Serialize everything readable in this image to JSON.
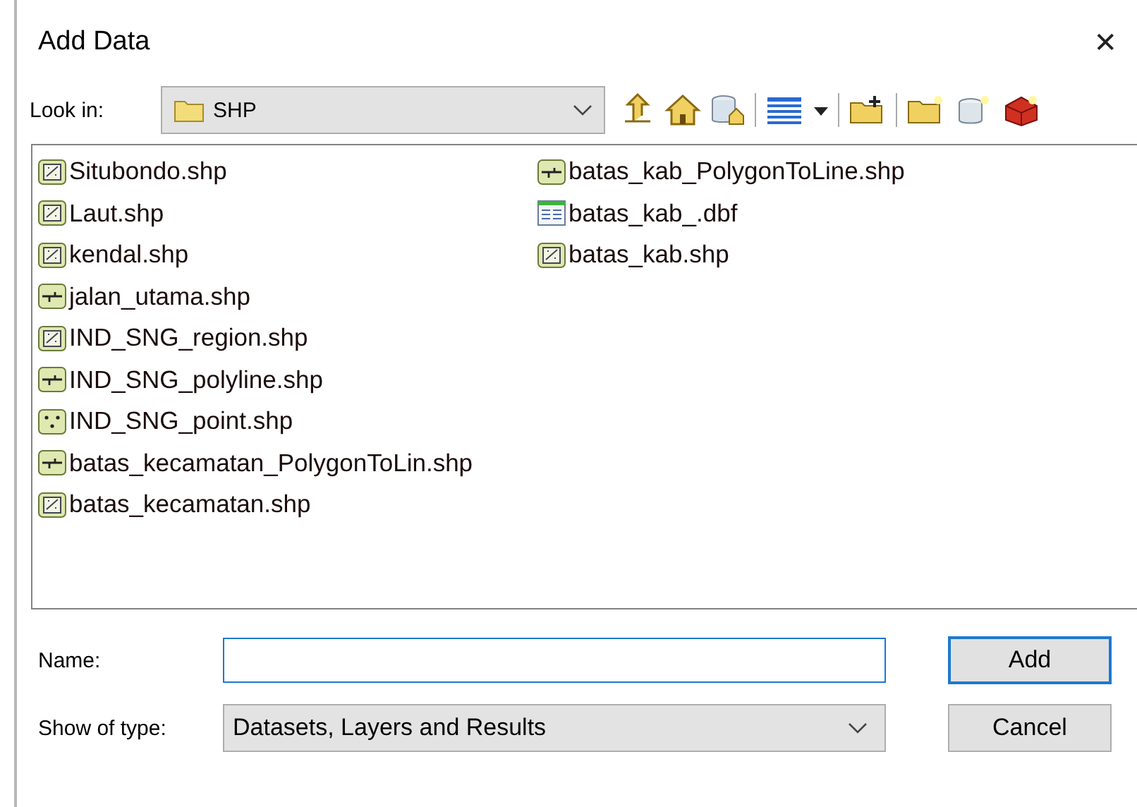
{
  "window": {
    "title": "Add Data",
    "close": "✕"
  },
  "look_in": {
    "label": "Look in:",
    "value": "SHP"
  },
  "files": [
    {
      "name": "Situbondo.shp",
      "kind": "polygon"
    },
    {
      "name": "Laut.shp",
      "kind": "polygon"
    },
    {
      "name": "kendal.shp",
      "kind": "polygon"
    },
    {
      "name": "jalan_utama.shp",
      "kind": "line"
    },
    {
      "name": "IND_SNG_region.shp",
      "kind": "polygon"
    },
    {
      "name": "IND_SNG_polyline.shp",
      "kind": "line"
    },
    {
      "name": "IND_SNG_point.shp",
      "kind": "point"
    },
    {
      "name": "batas_kecamatan_PolygonToLin.shp",
      "kind": "line"
    },
    {
      "name": "batas_kecamatan.shp",
      "kind": "polygon"
    },
    {
      "name": "batas_kab_PolygonToLine.shp",
      "kind": "line"
    },
    {
      "name": "batas_kab_.dbf",
      "kind": "table"
    },
    {
      "name": "batas_kab.shp",
      "kind": "polygon"
    }
  ],
  "name_field": {
    "label": "Name:"
  },
  "type_field": {
    "label": "Show of type:",
    "value": "Datasets, Layers and Results"
  },
  "buttons": [
    "Add",
    "Cancel"
  ]
}
